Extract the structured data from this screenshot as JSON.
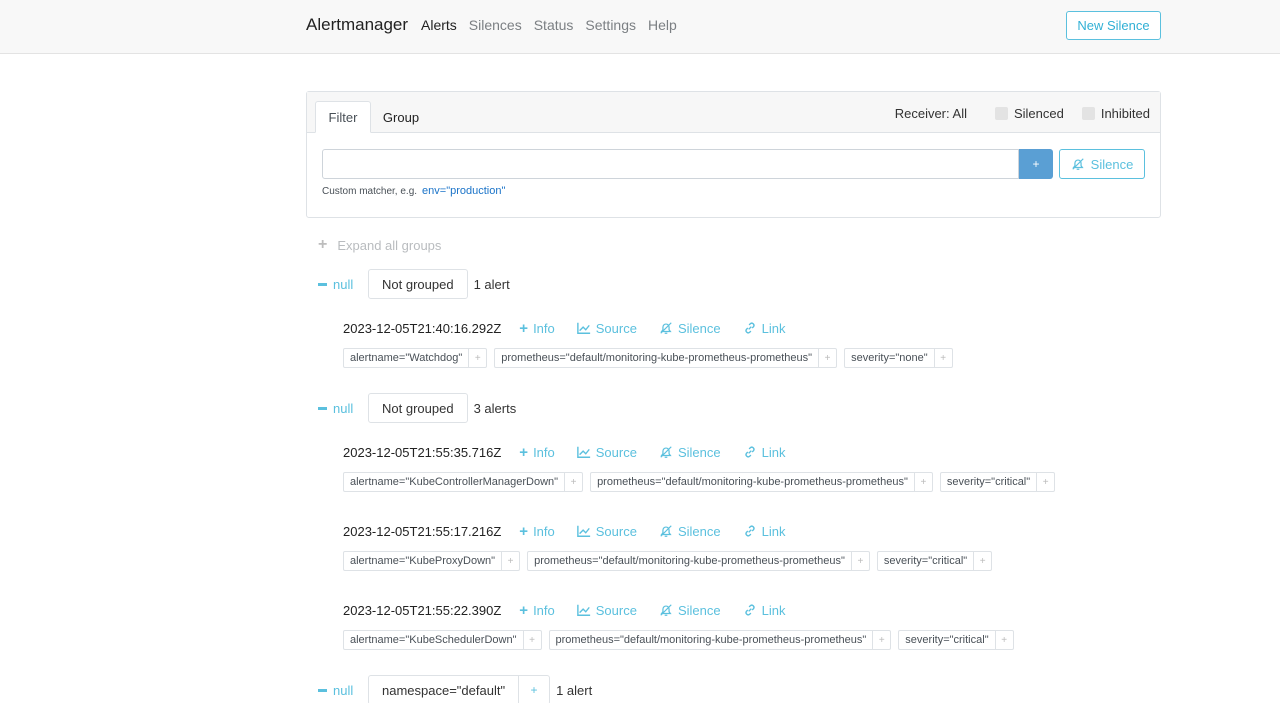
{
  "navbar": {
    "brand": "Alertmanager",
    "links": [
      "Alerts",
      "Silences",
      "Status",
      "Settings",
      "Help"
    ],
    "new_silence": "New Silence"
  },
  "filter": {
    "tabs": [
      "Filter",
      "Group"
    ],
    "receiver": "Receiver: All",
    "silenced": "Silenced",
    "inhibited": "Inhibited",
    "input_value": "",
    "add_label": "+",
    "silence_label": "Silence",
    "hint": "Custom matcher, e.g.",
    "hint_example": "env=\"production\""
  },
  "expand_all": "Expand all groups",
  "actions": {
    "info": "Info",
    "source": "Source",
    "silence": "Silence",
    "link": "Link"
  },
  "groups": [
    {
      "collapse_label": "null",
      "box": "Not grouped",
      "count": "1 alert",
      "alerts": [
        {
          "time": "2023-12-05T21:40:16.292Z",
          "labels": [
            "alertname=\"Watchdog\"",
            "prometheus=\"default/monitoring-kube-prometheus-prometheus\"",
            "severity=\"none\""
          ]
        }
      ]
    },
    {
      "collapse_label": "null",
      "box": "Not grouped",
      "count": "3 alerts",
      "alerts": [
        {
          "time": "2023-12-05T21:55:35.716Z",
          "labels": [
            "alertname=\"KubeControllerManagerDown\"",
            "prometheus=\"default/monitoring-kube-prometheus-prometheus\"",
            "severity=\"critical\""
          ]
        },
        {
          "time": "2023-12-05T21:55:17.216Z",
          "labels": [
            "alertname=\"KubeProxyDown\"",
            "prometheus=\"default/monitoring-kube-prometheus-prometheus\"",
            "severity=\"critical\""
          ]
        },
        {
          "time": "2023-12-05T21:55:22.390Z",
          "labels": [
            "alertname=\"KubeSchedulerDown\"",
            "prometheus=\"default/monitoring-kube-prometheus-prometheus\"",
            "severity=\"critical\""
          ]
        }
      ]
    },
    {
      "collapse_label": "null",
      "box": "namespace=\"default\"",
      "box_plus": "+",
      "count": "1 alert"
    }
  ]
}
